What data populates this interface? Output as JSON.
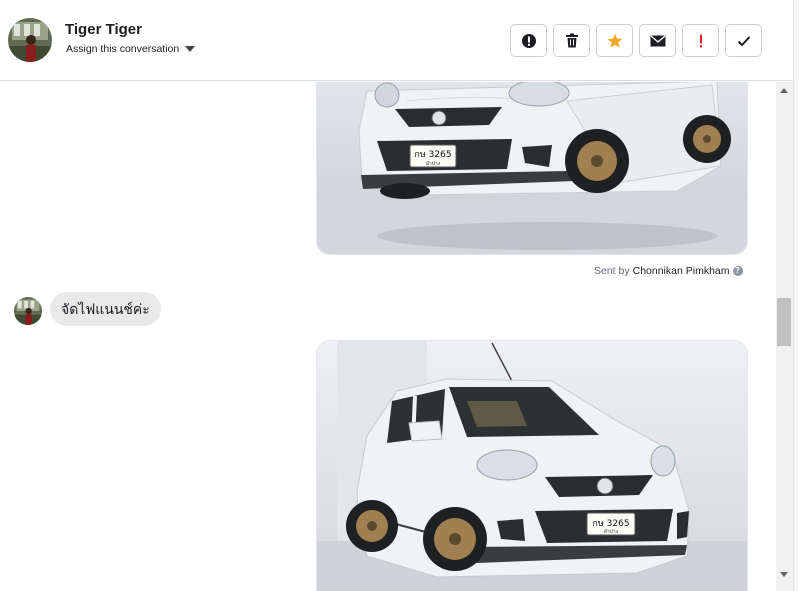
{
  "header": {
    "contact_name": "Tiger Tiger",
    "assign_label": "Assign this conversation",
    "actions": [
      {
        "name": "spam-button",
        "glyph": "!"
      },
      {
        "name": "delete-button",
        "glyph": "🗑"
      },
      {
        "name": "star-button",
        "glyph": "★"
      },
      {
        "name": "mark-unread-button",
        "glyph": "✉"
      },
      {
        "name": "important-button",
        "glyph": "!"
      },
      {
        "name": "done-button",
        "glyph": "✓"
      }
    ]
  },
  "thread": {
    "sent_by_prefix": "Sent by",
    "sent_by_name": "Chonnikan Pimkham",
    "incoming_message": "จัดไฟแนนช์ค่ะ",
    "plate_text": "กษ 3265",
    "plate_sub": "ลำปาง"
  },
  "colors": {
    "star": "#f5a623",
    "important": "#e02424",
    "car": "#eef3f3",
    "wheel": "#a08050"
  }
}
